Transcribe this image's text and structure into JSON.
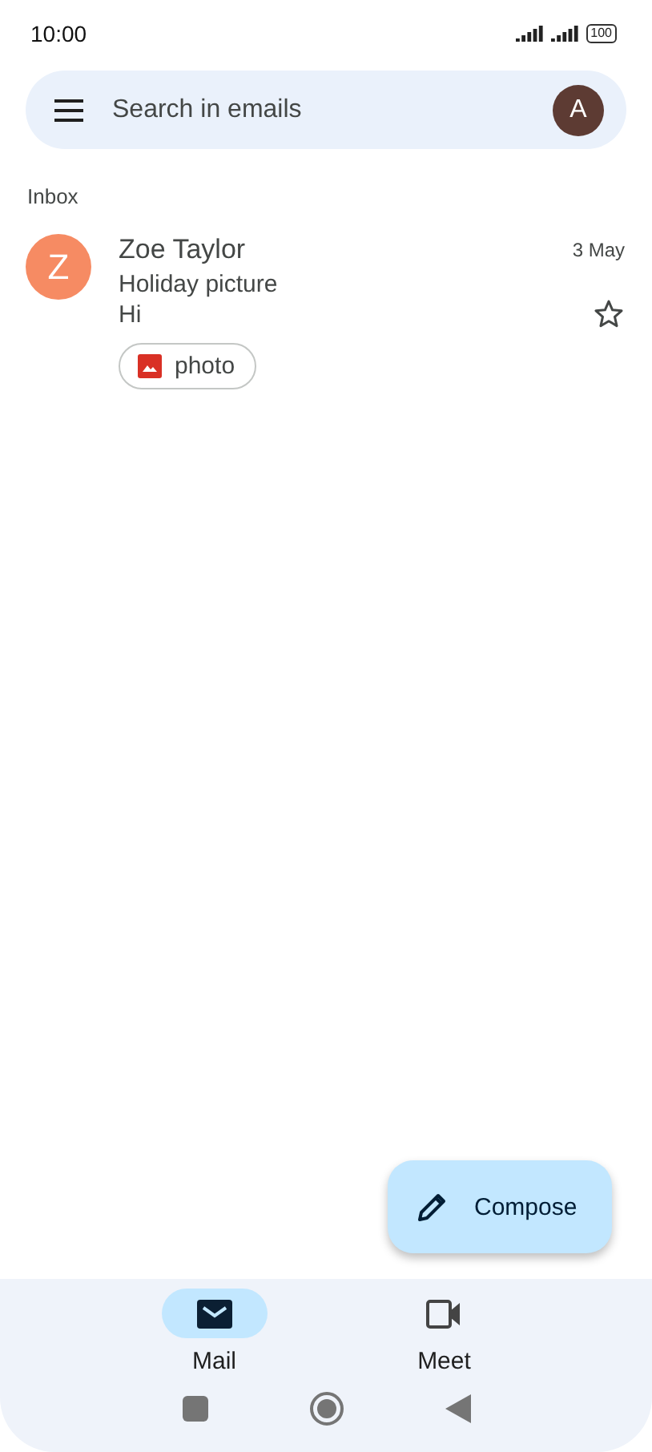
{
  "status_bar": {
    "time": "10:00",
    "battery": "100"
  },
  "search": {
    "placeholder": "Search in emails",
    "avatar": "A"
  },
  "section_label": "Inbox",
  "emails": [
    {
      "avatar": "Z",
      "color": "#f68b63",
      "sender": "Zoe Taylor",
      "date": "3 May",
      "subject": "Holiday picture",
      "snippet": "Hi",
      "starred": false,
      "attachments": [
        {
          "label": "photo"
        }
      ]
    }
  ],
  "compose": {
    "label": "Compose"
  },
  "nav": [
    {
      "kind": "mail",
      "label": "Mail",
      "selected": true
    },
    {
      "kind": "meet",
      "label": "Meet",
      "selected": false
    }
  ]
}
